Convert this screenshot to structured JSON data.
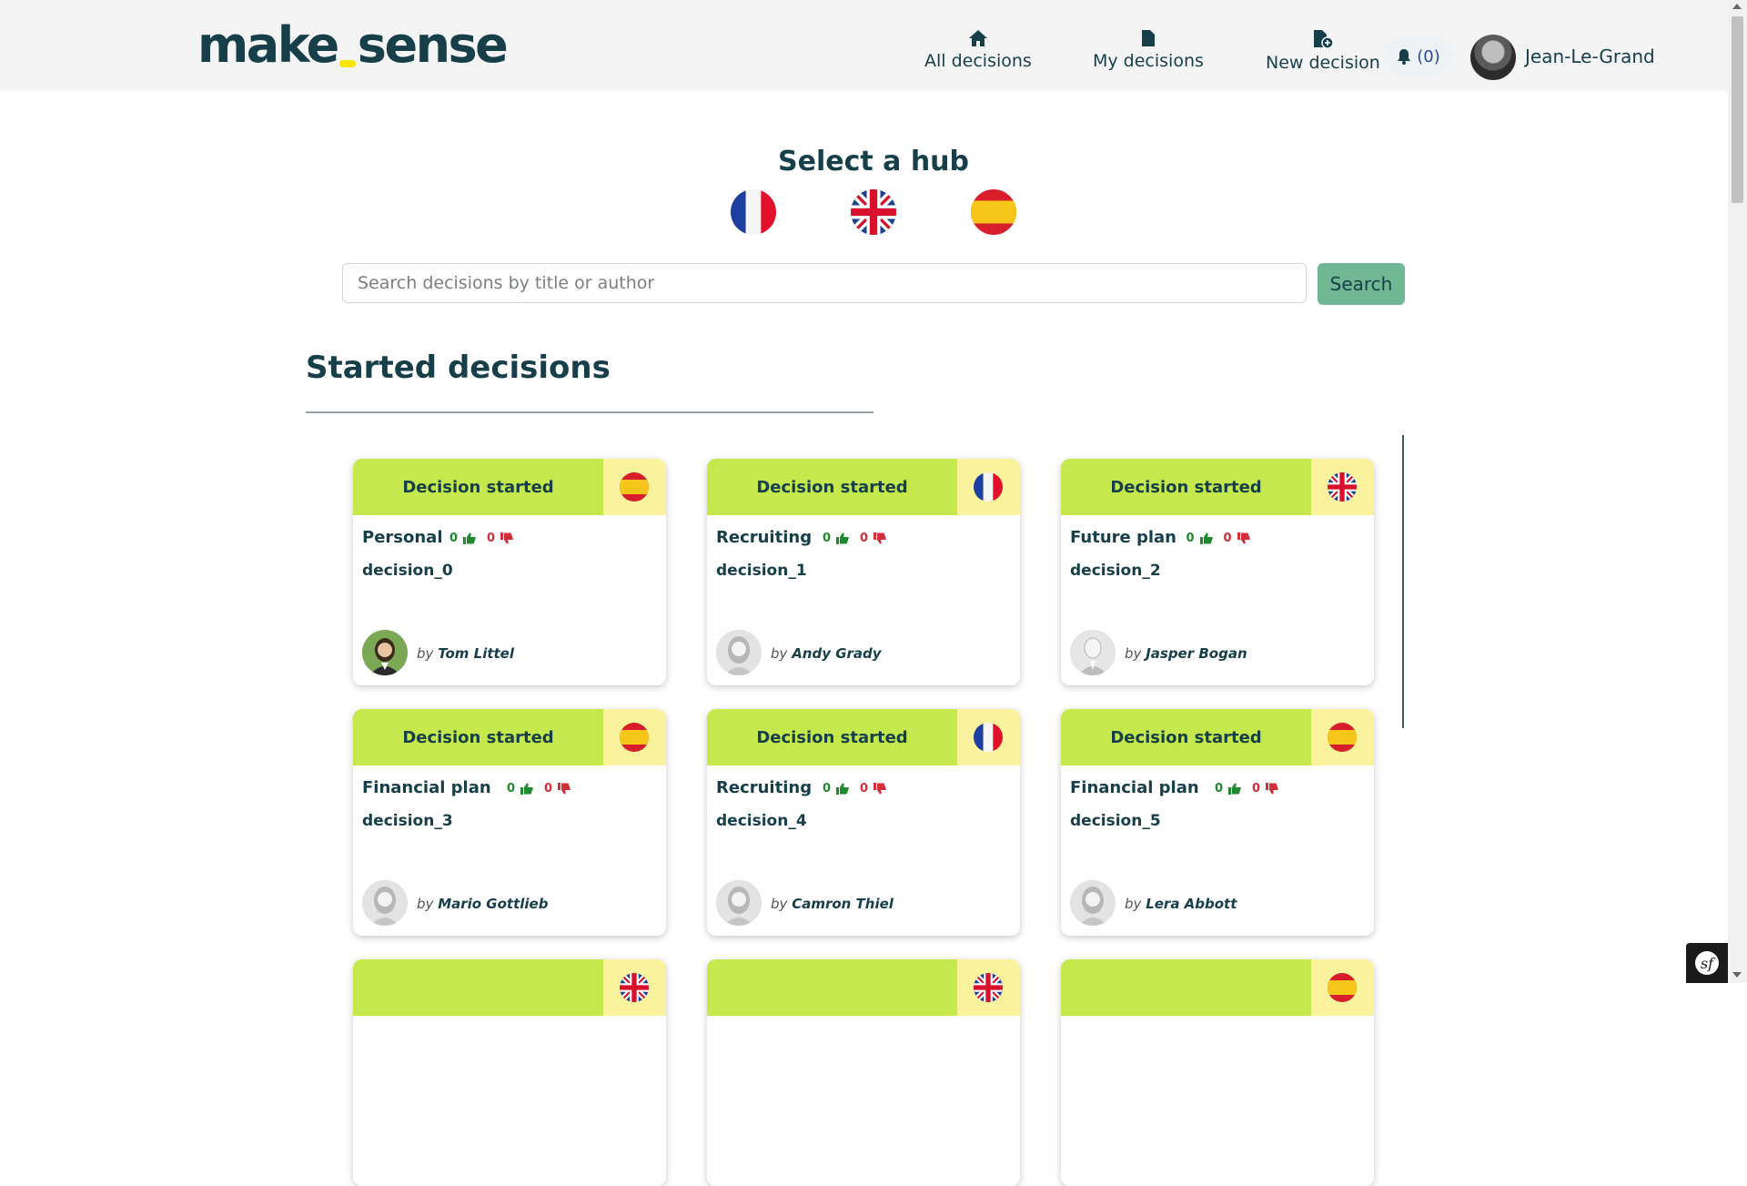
{
  "header": {
    "logo": {
      "part1": "make",
      "part2": "sense"
    },
    "nav": [
      {
        "label": "All decisions",
        "icon": "home-icon"
      },
      {
        "label": "My decisions",
        "icon": "file-icon"
      },
      {
        "label": "New decision",
        "icon": "file-plus-icon"
      }
    ],
    "notifications": {
      "count": "(0)",
      "icon": "bell-icon"
    },
    "user": {
      "name": "Jean-Le-Grand"
    }
  },
  "hub": {
    "title": "Select a hub",
    "flags": [
      "fr",
      "gb",
      "es"
    ]
  },
  "search": {
    "placeholder": "Search decisions by title or author",
    "button": "Search"
  },
  "section": {
    "title": "Started decisions"
  },
  "colors": {
    "accent_green": "#c5e84c",
    "flag_box": "#fbf29e",
    "search_button": "#6fb893",
    "brand_dark": "#173f4a",
    "thumb_up": "#1f8a2e",
    "thumb_down": "#d32f3a"
  },
  "cards": [
    {
      "status": "Decision started",
      "flag": "es",
      "category": "Personal",
      "up": "0",
      "down": "0",
      "title": "decision_0",
      "by": "by",
      "author": "Tom Littel",
      "avatar": "photo-woman"
    },
    {
      "status": "Decision started",
      "flag": "fr",
      "category": "Recruiting",
      "up": "0",
      "down": "0",
      "title": "decision_1",
      "by": "by",
      "author": "Andy Grady",
      "avatar": "placeholder-female"
    },
    {
      "status": "Decision started",
      "flag": "gb",
      "category": "Future plan",
      "up": "0",
      "down": "0",
      "title": "decision_2",
      "by": "by",
      "author": "Jasper Bogan",
      "avatar": "placeholder-male"
    },
    {
      "status": "Decision started",
      "flag": "es",
      "category": "Financial plan",
      "up": "0",
      "down": "0",
      "title": "decision_3",
      "by": "by",
      "author": "Mario Gottlieb",
      "avatar": "placeholder-female"
    },
    {
      "status": "Decision started",
      "flag": "fr",
      "category": "Recruiting",
      "up": "0",
      "down": "0",
      "title": "decision_4",
      "by": "by",
      "author": "Camron Thiel",
      "avatar": "placeholder-female"
    },
    {
      "status": "Decision started",
      "flag": "es",
      "category": "Financial plan",
      "up": "0",
      "down": "0",
      "title": "decision_5",
      "by": "by",
      "author": "Lera Abbott",
      "avatar": "placeholder-female"
    }
  ],
  "partial_cards_flags": [
    "gb",
    "gb",
    "es"
  ]
}
